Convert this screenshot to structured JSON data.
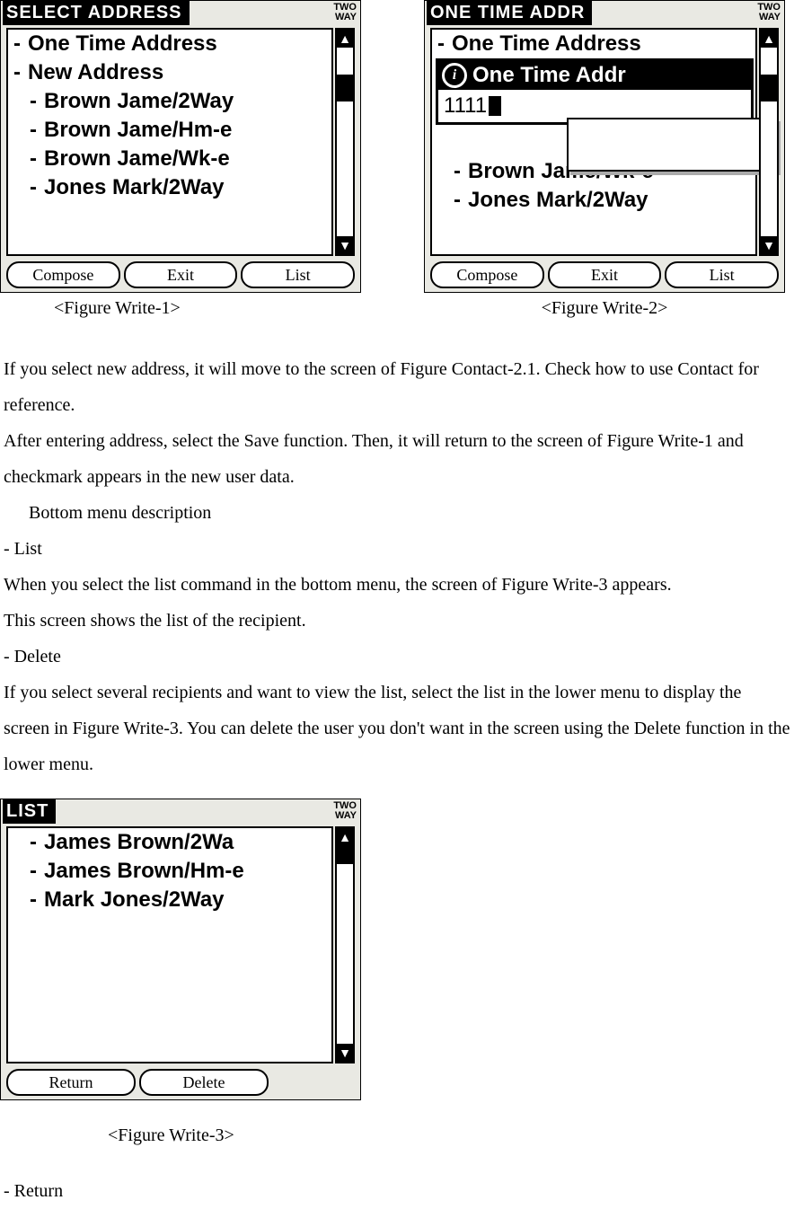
{
  "fig1": {
    "title": "SELECT ADDRESS",
    "indicator_line1": "TWO",
    "indicator_line2": "WAY",
    "items": [
      "One Time Address",
      "New Address",
      "Brown Jame/2Way",
      "Brown Jame/Hm-e",
      "Brown Jame/Wk-e",
      "Jones Mark/2Way"
    ],
    "softkeys": [
      "Compose",
      "Exit",
      "List"
    ],
    "caption": "<Figure Write-1>"
  },
  "fig2": {
    "title": "ONE TIME ADDR",
    "indicator_line1": "TWO",
    "indicator_line2": "WAY",
    "top_item": "One Time Address",
    "below_items": [
      "Brown Jame/Wk-e",
      "Jones Mark/2Way"
    ],
    "popup_title": "One Time Addr",
    "popup_value": "1111",
    "softkeys": [
      "Compose",
      "Exit",
      "List"
    ],
    "caption": "<Figure Write-2>"
  },
  "fig3": {
    "title": "LIST",
    "indicator_line1": "TWO",
    "indicator_line2": "WAY",
    "items": [
      "James Brown/2Wa",
      "James Brown/Hm-e",
      "Mark Jones/2Way"
    ],
    "softkeys": [
      "Return",
      "Delete"
    ],
    "caption": "<Figure Write-3>"
  },
  "body": {
    "p1": "If you select new address, it will move to the screen of Figure Contact-2.1. Check how to use Contact for reference.",
    "p2": "After entering address, select the Save function. Then, it will return to the screen of Figure Write-1 and checkmark appears in the new user data.",
    "p3": "Bottom menu description",
    "p4": "- List",
    "p5": "When you select the list command in the bottom menu, the screen of Figure Write-3 appears.",
    "p6": "This screen shows the list of the recipient.",
    "p7": "- Delete",
    "p8": "If you select several recipients and want to view the list, select the list in the lower menu to display the screen in Figure Write-3. You can delete the user you don't want in the screen using the Delete function in the lower menu.",
    "p9": "- Return"
  }
}
